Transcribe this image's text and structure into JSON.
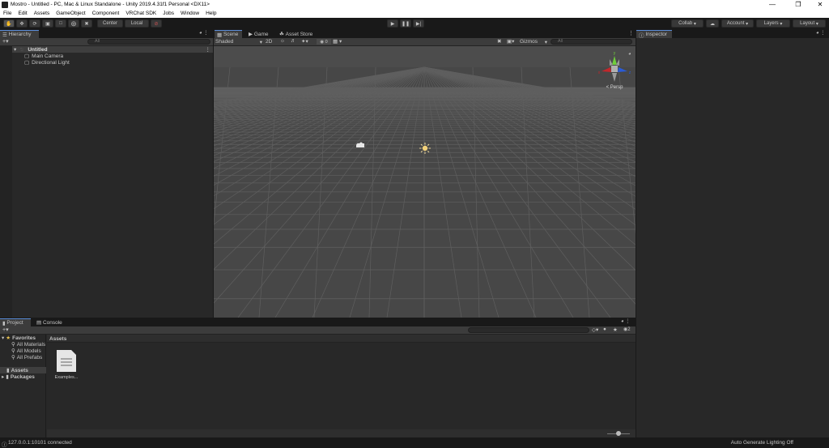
{
  "window": {
    "title": "Mostro - Untitled - PC, Mac & Linux Standalone - Unity 2019.4.31f1 Personal <DX11>"
  },
  "menu": [
    "File",
    "Edit",
    "Assets",
    "GameObject",
    "Component",
    "VRChat SDK",
    "Jobs",
    "Window",
    "Help"
  ],
  "toolbar": {
    "pivot_label": "Center",
    "space_label": "Local",
    "collab_label": "Collab",
    "account_label": "Account",
    "layers_label": "Layers",
    "layout_label": "Layout"
  },
  "hierarchy": {
    "tab": "Hierarchy",
    "search_placeholder": "All",
    "scene": "Untitled",
    "objects": [
      "Main Camera",
      "Directional Light"
    ]
  },
  "scene_view": {
    "tabs": [
      "Scene",
      "Game",
      "Asset Store"
    ],
    "shading": "Shaded",
    "mode_2d": "2D",
    "fx_count": "0",
    "gizmos": "Gizmos",
    "search_placeholder": "All",
    "persp": "< Persp",
    "gizmo_axes": {
      "y": "y",
      "x": "x",
      "z": "z"
    }
  },
  "inspector": {
    "tab": "Inspector"
  },
  "project": {
    "tabs": [
      "Project",
      "Console"
    ],
    "favorites_label": "Favorites",
    "favorites": [
      "All Materials",
      "All Models",
      "All Prefabs"
    ],
    "assets_label": "Assets",
    "packages_label": "Packages",
    "breadcrumb": "Assets",
    "asset_items": [
      {
        "name": "Examples..."
      }
    ],
    "layers_count": "2"
  },
  "status": {
    "left": "127.0.0.1:10101 connected",
    "right": "Auto Generate Lighting Off"
  },
  "colors": {
    "accent": "#5b8dd9",
    "panel": "#282828",
    "background": "#191919"
  }
}
